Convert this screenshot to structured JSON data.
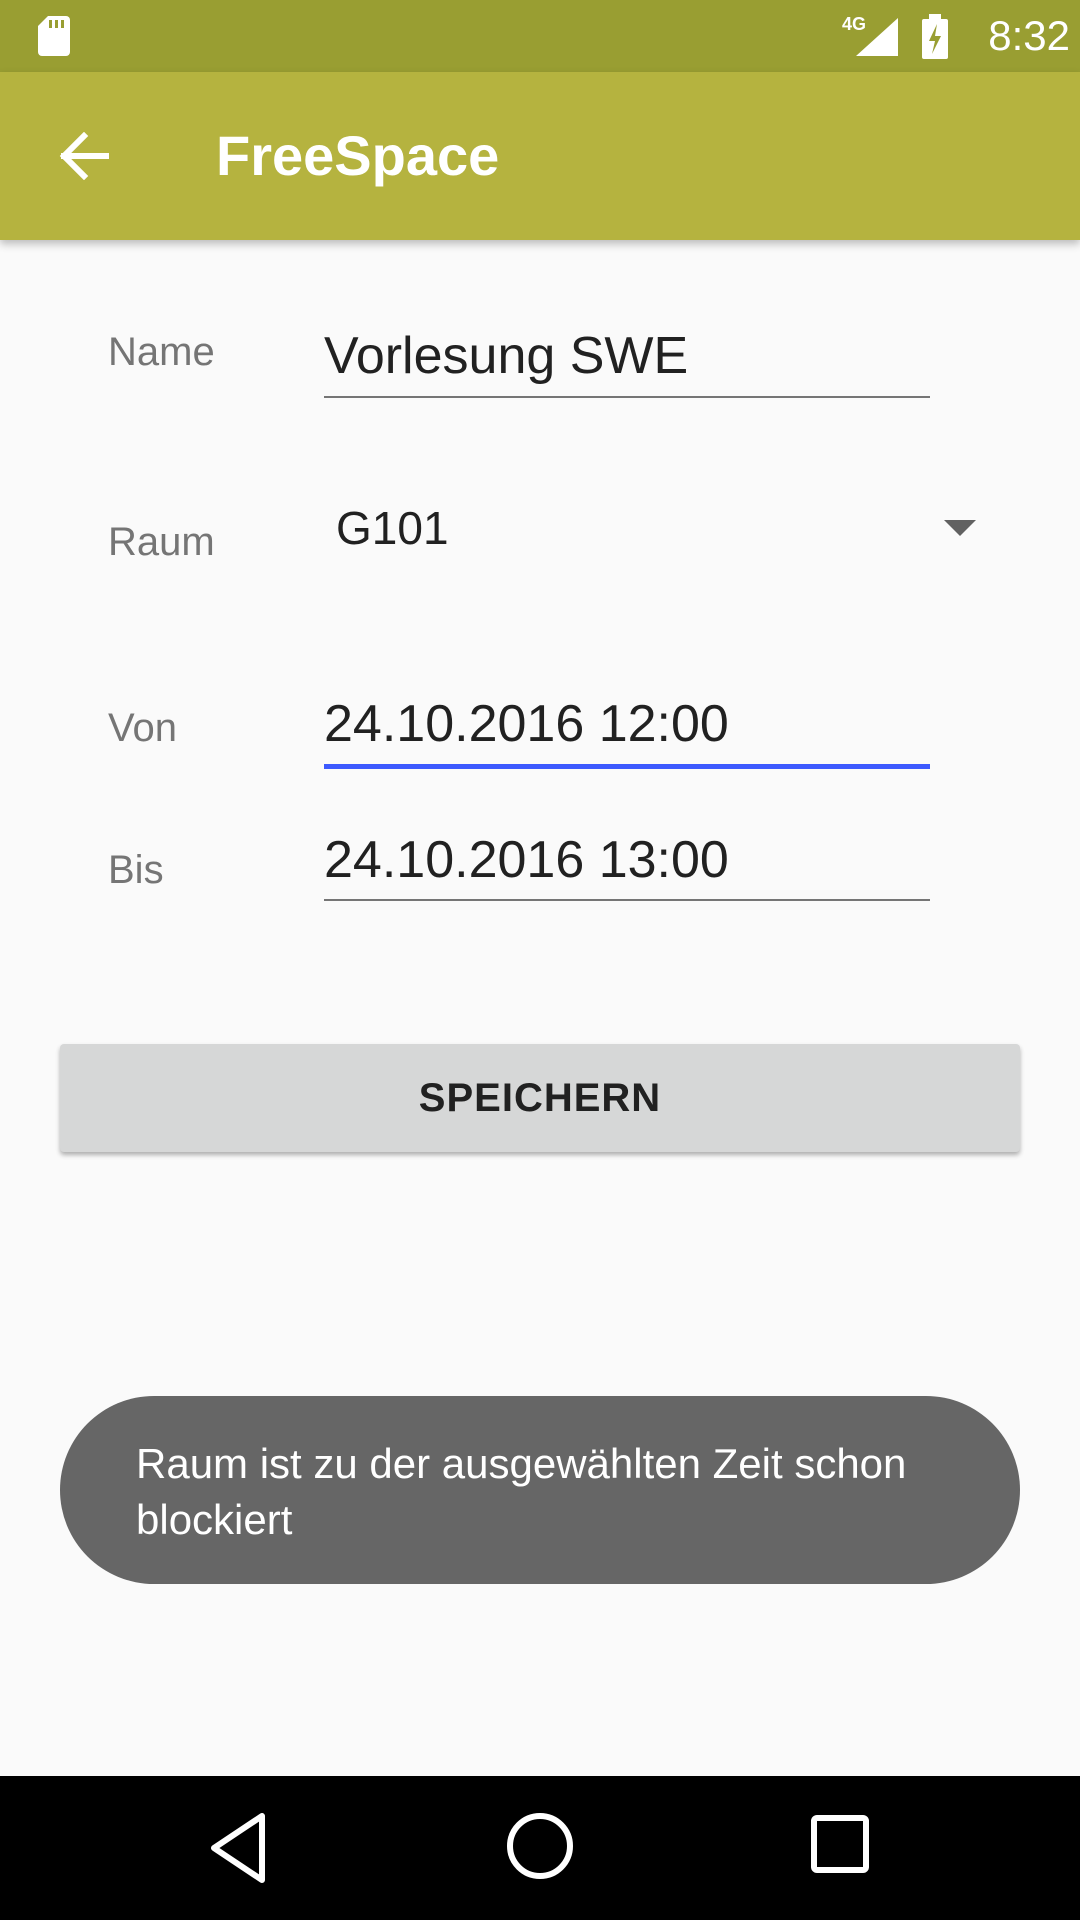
{
  "status_bar": {
    "time": "8:32",
    "network": "4G",
    "icons": [
      "sd-card-icon",
      "signal-icon",
      "battery-charging-icon"
    ]
  },
  "app_bar": {
    "title": "FreeSpace",
    "back_icon": "arrow-back-icon"
  },
  "form": {
    "name": {
      "label": "Name",
      "value": "Vorlesung SWE"
    },
    "room": {
      "label": "Raum",
      "value": "G101"
    },
    "from": {
      "label": "Von",
      "value": "24.10.2016 12:00"
    },
    "to": {
      "label": "Bis",
      "value": "24.10.2016 13:00"
    },
    "save_label": "SPEICHERN"
  },
  "toast": {
    "message": "Raum ist zu der ausgewählten Zeit schon blockiert"
  },
  "nav_bar": {
    "icons": [
      "nav-back-icon",
      "nav-home-icon",
      "nav-recents-icon"
    ]
  },
  "colors": {
    "status_bar": "#999e32",
    "app_bar": "#b5b33f",
    "accent": "#3d5afe",
    "toast": "#666666"
  }
}
